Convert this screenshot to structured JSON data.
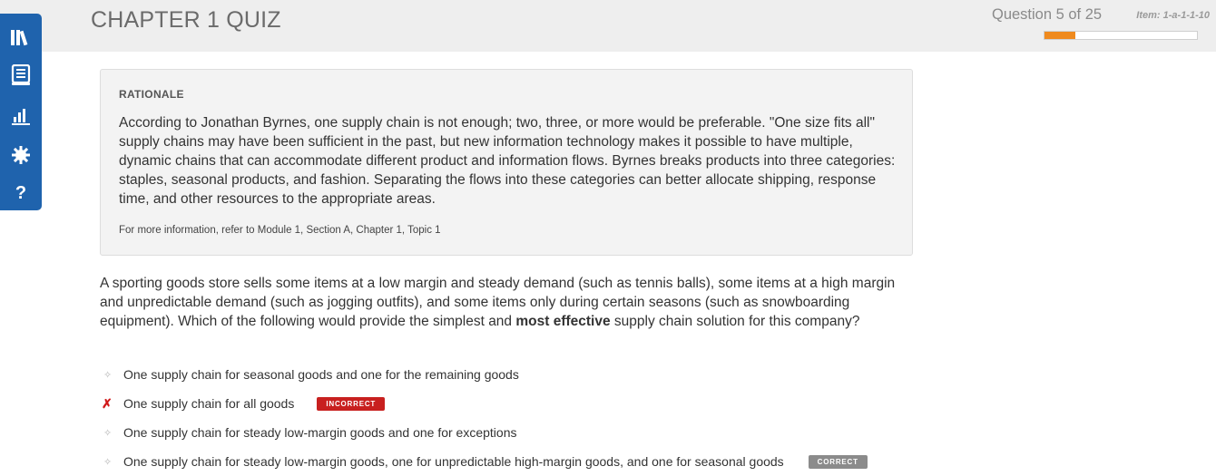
{
  "header": {
    "title": "CHAPTER 1 QUIZ",
    "question_counter": "Question 5 of 25",
    "item_id": "Item: 1-a-1-1-10",
    "progress_fraction": 0.2,
    "accent_color": "#ef8a1e"
  },
  "sidebar": {
    "color": "#1f63ad",
    "items": [
      {
        "icon": "library-icon"
      },
      {
        "icon": "notebook-icon"
      },
      {
        "icon": "bar-chart-icon"
      },
      {
        "icon": "gear-icon"
      },
      {
        "icon": "help-icon",
        "label": "?"
      }
    ]
  },
  "rationale": {
    "heading": "RATIONALE",
    "body": "According to Jonathan Byrnes, one supply chain is not enough; two, three, or more would be preferable. \"One size fits all\" supply chains may have been sufficient in the past, but new information technology makes it possible to have multiple, dynamic chains that can accommodate different product and information flows. Byrnes breaks products into three categories: staples, seasonal products, and fashion. Separating the flows into these categories can better allocate shipping, response time, and other resources to the appropriate areas.",
    "reference": "For more information, refer to Module 1, Section A, Chapter 1, Topic 1"
  },
  "question": {
    "text_before": "A sporting goods store sells some items at a low margin and steady demand (such as tennis balls), some items at a high margin and unpredictable demand (such as jogging outfits), and some items only during certain seasons (such as snowboarding equipment). Which of the following would provide the simplest and ",
    "text_bold": "most effective",
    "text_after": " supply chain solution for this company?"
  },
  "options": [
    {
      "text": "One supply chain for seasonal goods and one for the remaining goods",
      "marker": "✧",
      "badge": ""
    },
    {
      "text": "One supply chain for all goods",
      "marker": "✗",
      "badge": "INCORRECT"
    },
    {
      "text": "One supply chain for steady low-margin goods and one for exceptions",
      "marker": "✧",
      "badge": ""
    },
    {
      "text": "One supply chain for steady low-margin goods, one for unpredictable high-margin goods, and one for seasonal goods",
      "marker": "✧",
      "badge": "CORRECT"
    }
  ],
  "status_colors": {
    "incorrect": "#c8201f",
    "correct": "#8b8b8b"
  }
}
